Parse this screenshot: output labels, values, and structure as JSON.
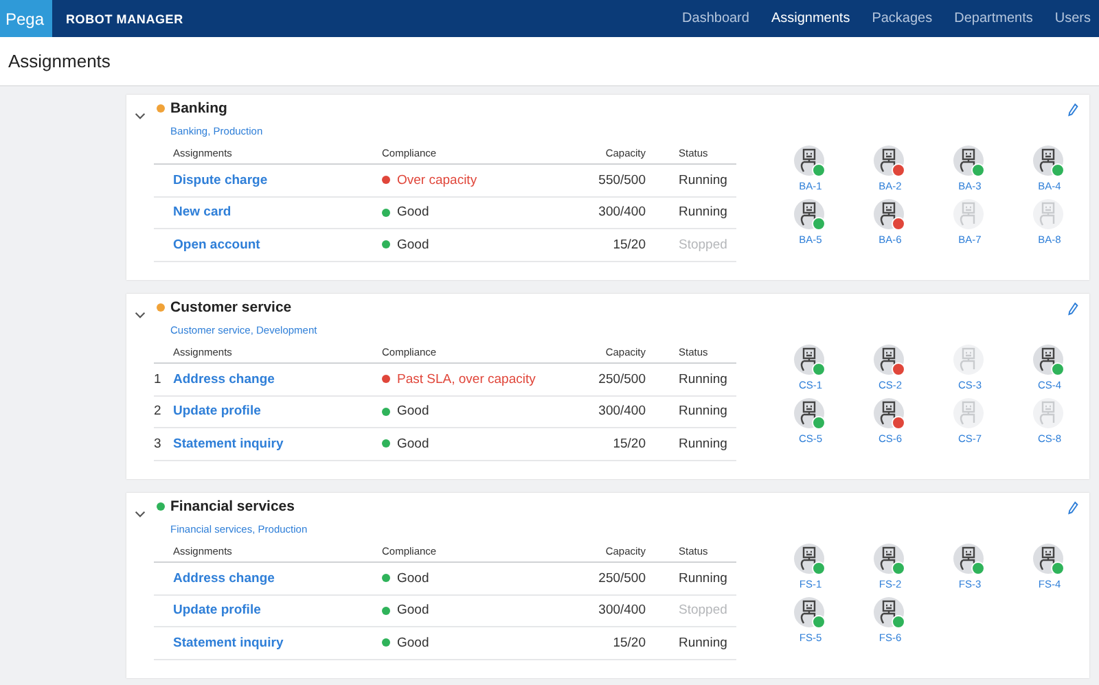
{
  "header": {
    "logo": "Pega",
    "product": "ROBOT MANAGER",
    "nav": [
      {
        "label": "Dashboard",
        "selected": false
      },
      {
        "label": "Assignments",
        "selected": true
      },
      {
        "label": "Packages",
        "selected": false
      },
      {
        "label": "Departments",
        "selected": false
      },
      {
        "label": "Users",
        "selected": false
      }
    ]
  },
  "page_title": "Assignments",
  "groups": [
    {
      "name": "Banking",
      "subtitle": "Banking, Production",
      "color": "#f0a238",
      "expanded": true,
      "columns": [
        "Assignments",
        "Compliance",
        "Capacity",
        "Status"
      ],
      "rows": [
        {
          "assignment": "Dispute charge",
          "compliance": "Over capacity",
          "color": "#e0463a",
          "capacity": "550/500",
          "status": "Running",
          "running": true
        },
        {
          "assignment": "New card",
          "compliance": "Good",
          "color": "#2fb35a",
          "capacity": "300/400",
          "status": "Running",
          "running": true
        },
        {
          "assignment": "Open account",
          "compliance": "Good",
          "color": "#2fb35a",
          "capacity": "15/20",
          "status": "Stopped",
          "running": false
        }
      ],
      "robots": [
        {
          "label": "BA-1",
          "online": true,
          "error": false
        },
        {
          "label": "BA-2",
          "online": true,
          "error": true
        },
        {
          "label": "BA-3",
          "online": true,
          "error": false
        },
        {
          "label": "BA-4",
          "online": true,
          "error": false
        },
        {
          "label": "BA-5",
          "online": true,
          "error": false
        },
        {
          "label": "BA-6",
          "online": true,
          "error": true
        },
        {
          "label": "BA-7",
          "online": false
        },
        {
          "label": "BA-8",
          "online": false
        }
      ]
    },
    {
      "name": "Customer service",
      "subtitle": "Customer service, Development",
      "color": "#f0a238",
      "expanded": true,
      "columns": [
        "Assignments",
        "Compliance",
        "Capacity",
        "Status"
      ],
      "rows": [
        {
          "number": "1",
          "assignment": "Address change",
          "compliance": "Past SLA, over capacity",
          "color": "#e0463a",
          "capacity": "250/500",
          "status": "Running",
          "running": true
        },
        {
          "number": "2",
          "assignment": "Update profile",
          "compliance": "Good",
          "color": "#2fb35a",
          "capacity": "300/400",
          "status": "Running",
          "running": true
        },
        {
          "number": "3",
          "assignment": "Statement inquiry",
          "compliance": "Good",
          "color": "#2fb35a",
          "capacity": "15/20",
          "status": "Running",
          "running": true
        }
      ],
      "robots": [
        {
          "label": "CS-1",
          "online": true,
          "error": false
        },
        {
          "label": "CS-2",
          "online": true,
          "error": true
        },
        {
          "label": "CS-3",
          "online": false
        },
        {
          "label": "CS-4",
          "online": true,
          "error": false
        },
        {
          "label": "CS-5",
          "online": true,
          "error": false
        },
        {
          "label": "CS-6",
          "online": true,
          "error": true
        },
        {
          "label": "CS-7",
          "online": false
        },
        {
          "label": "CS-8",
          "online": false
        }
      ]
    },
    {
      "name": "Financial services",
      "subtitle": "Financial services, Production",
      "color": "#2fb35a",
      "expanded": true,
      "columns": [
        "Assignments",
        "Compliance",
        "Capacity",
        "Status"
      ],
      "rows": [
        {
          "assignment": "Address change",
          "compliance": "Good",
          "color": "#2fb35a",
          "capacity": "250/500",
          "status": "Running",
          "running": true
        },
        {
          "assignment": "Update profile",
          "compliance": "Good",
          "color": "#2fb35a",
          "capacity": "300/400",
          "status": "Stopped",
          "running": false
        },
        {
          "assignment": "Statement inquiry",
          "compliance": "Good",
          "color": "#2fb35a",
          "capacity": "15/20",
          "status": "Running",
          "running": true
        }
      ],
      "robots": [
        {
          "label": "FS-1",
          "online": true,
          "error": false
        },
        {
          "label": "FS-2",
          "online": true,
          "error": false
        },
        {
          "label": "FS-3",
          "online": true,
          "error": false
        },
        {
          "label": "FS-4",
          "online": true,
          "error": false
        },
        {
          "label": "FS-5",
          "online": true,
          "error": false
        },
        {
          "label": "FS-6",
          "online": true,
          "error": false
        }
      ]
    }
  ]
}
